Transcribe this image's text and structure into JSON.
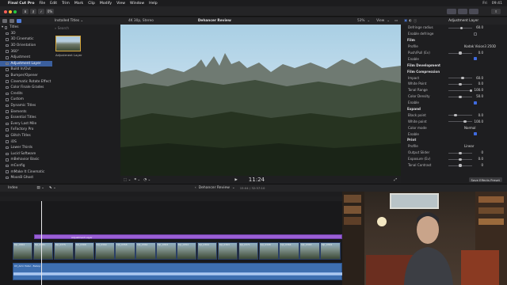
{
  "menubar": {
    "app_name": "Final Cut Pro",
    "items": [
      "File",
      "Edit",
      "Trim",
      "Mark",
      "Clip",
      "Modify",
      "View",
      "Window",
      "Help"
    ],
    "right_items": [
      "Fri",
      "09:41"
    ]
  },
  "toolbar": {
    "badge": "0%"
  },
  "browser": {
    "tree_header": "Titles",
    "library_title": "Installed Titles",
    "search_placeholder": "Search",
    "selected_item": "Adjustment Layer",
    "clip_label": "Adjustment Layer",
    "items": [
      "3D",
      "3D Cinematic",
      "3D Orientation",
      "360°",
      "Adjustment",
      "Adjustment Layer",
      "Build In/Out",
      "Bumper/Opener",
      "Cinematic Rotate Effect",
      "Color Finale Grades",
      "Credits",
      "Custom",
      "Dynamic Titles",
      "Elements",
      "Essential Titles",
      "Every Last Mile",
      "FxFactory Pro",
      "Glitch Titles",
      "iOS",
      "Lower Thirds",
      "Lucid Software",
      "mBehavior Basic",
      "mConfig",
      "mMake It Cinematic",
      "MoonB Ghost"
    ]
  },
  "viewer": {
    "format": "4K 30p, Stereo",
    "title": "Dehancer Review",
    "zoom": "53%",
    "view_label": "View",
    "timecode": "11:24"
  },
  "inspector": {
    "title": "Adjustment Layer",
    "save_preset": "Save Effects Preset",
    "rows": [
      {
        "label": "Defringe radius",
        "kind": "slider",
        "value": "60.0",
        "pos": 0.55
      },
      {
        "label": "Enable defringe",
        "kind": "check",
        "on": false
      },
      {
        "label": "Film",
        "kind": "section"
      },
      {
        "label": "Profile",
        "kind": "select",
        "value": "Kodak Vision3 250D"
      },
      {
        "label": "Push/Pull (Ev)",
        "kind": "slider",
        "value": "0.0",
        "pos": 0.5
      },
      {
        "label": "Enable",
        "kind": "check",
        "on": true
      },
      {
        "label": "Film Development",
        "kind": "section"
      },
      {
        "label": "Film Compression",
        "kind": "section"
      },
      {
        "label": "Impact",
        "kind": "slider",
        "value": "60.0",
        "pos": 0.6
      },
      {
        "label": "White Point",
        "kind": "slider",
        "value": "0.0",
        "pos": 0.5
      },
      {
        "label": "Tonal Range",
        "kind": "slider",
        "value": "100.0",
        "pos": 0.95
      },
      {
        "label": "Color Density",
        "kind": "slider",
        "value": "50.0",
        "pos": 0.5
      },
      {
        "label": "Enable",
        "kind": "check",
        "on": true
      },
      {
        "label": "Expand",
        "kind": "section"
      },
      {
        "label": "Black point",
        "kind": "slider",
        "value": "0.0",
        "pos": 0.3
      },
      {
        "label": "White point",
        "kind": "slider",
        "value": "100.0",
        "pos": 0.7
      },
      {
        "label": "Color mode",
        "kind": "select",
        "value": "Normal"
      },
      {
        "label": "Enable",
        "kind": "check",
        "on": true
      },
      {
        "label": "Print",
        "kind": "section"
      },
      {
        "label": "Profile",
        "kind": "select",
        "value": "Linear"
      },
      {
        "label": "Output Slider",
        "kind": "slider",
        "value": "0",
        "pos": 0.5
      },
      {
        "label": "Exposure (Ev)",
        "kind": "slider",
        "value": "0.0",
        "pos": 0.5
      },
      {
        "label": "Tonal Contrast",
        "kind": "slider",
        "value": "0",
        "pos": 0.5
      }
    ]
  },
  "timeline": {
    "index_label": "Index",
    "project_title": "Dehancer Review",
    "duration": "15:04 / 32:57:10",
    "adjustment_label": "Adjustment Layer",
    "audio_label": "03_Amir Patel - Bebop",
    "clips": [
      "DJI_0364",
      "DJI_0381",
      "DJI_0375",
      "DJI_0368",
      "DJI_0369",
      "DJI_0358",
      "DJI_0364",
      "DJI_0363",
      "DJI_0352",
      "DJI_0364",
      "DJI_0363",
      "DJI_0371",
      "DJI_0308",
      "DJI_0364",
      "DJI_0363",
      "DJI_0364"
    ]
  },
  "colors": {
    "accent": "#3f6be0",
    "selection": "#3b5f9e",
    "adjustment": "#9b5fd6",
    "audio": "#3e6fb0"
  }
}
